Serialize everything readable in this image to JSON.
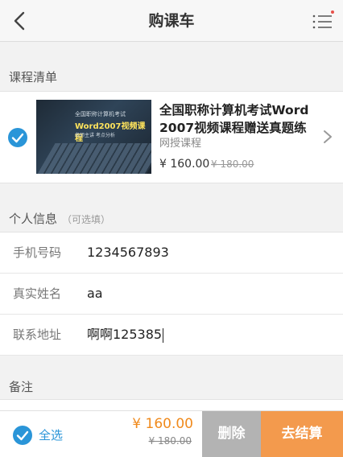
{
  "header": {
    "title": "购课车"
  },
  "course_section": {
    "label": "课程清单"
  },
  "course": {
    "title": "全国职称计算机考试Word 2007视频课程赠送真题练",
    "subtitle": "网授课程",
    "price": "¥ 160.00",
    "old_price": "¥ 180.00",
    "thumb_line1": "全国职称计算机考试",
    "thumb_line2": "Word2007视频课程",
    "thumb_line3": "名师主讲 考点分析"
  },
  "info_section": {
    "label": "个人信息",
    "hint": "（可选填）"
  },
  "fields": [
    {
      "label": "手机号码",
      "value": "1234567893"
    },
    {
      "label": "真实姓名",
      "value": "aa"
    },
    {
      "label": "联系地址",
      "value": "啊啊125385"
    }
  ],
  "remark_section": {
    "label": "备注"
  },
  "footer": {
    "select_all": "全选",
    "total": "¥ 160.00",
    "total_old": "¥ 180.00",
    "delete": "删除",
    "checkout": "去结算"
  },
  "colors": {
    "accent": "#2a95d8",
    "price": "#f08a1c",
    "checkout": "#f39a4d",
    "delete": "#b3b3b3"
  }
}
